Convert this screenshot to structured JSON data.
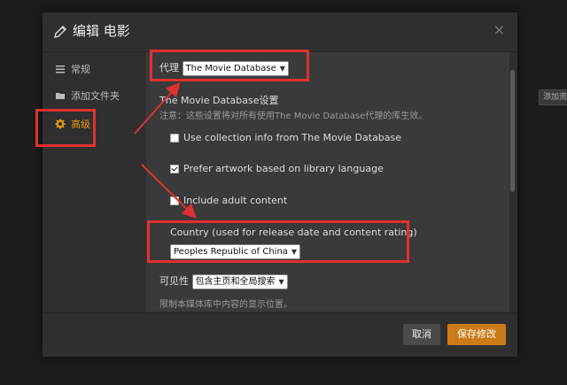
{
  "background": {
    "chip_label": "添加资"
  },
  "dialog": {
    "title": "编辑 电影",
    "close_glyph": "×"
  },
  "sidebar": {
    "items": [
      {
        "label": "常规",
        "icon": "list-icon"
      },
      {
        "label": "添加文件夹",
        "icon": "folder-icon"
      },
      {
        "label": "高级",
        "icon": "gear-icon",
        "active": true
      }
    ]
  },
  "content": {
    "agent_label": "代理",
    "agent_value": "The Movie Database",
    "settings_heading": "The Movie Database设置",
    "settings_note": "注意：这些设置将对所有使用The Movie Database代理的库生效。",
    "checkboxes": [
      {
        "label": "Use collection info from The Movie Database",
        "checked": false
      },
      {
        "label": "Prefer artwork based on library language",
        "checked": true
      },
      {
        "label": "Include adult content",
        "checked": false
      }
    ],
    "country_label": "Country (used for release date and content rating)",
    "country_value": "Peoples Republic of China",
    "visibility_label": "可见性",
    "visibility_value": "包含主页和全局搜索",
    "visibility_note": "限制本媒体库中内容的显示位置。"
  },
  "footer": {
    "cancel_label": "取消",
    "save_label": "保存修改"
  },
  "colors": {
    "accent": "#e5a00d",
    "save_button": "#cc7b19",
    "annotation": "#e03030"
  }
}
